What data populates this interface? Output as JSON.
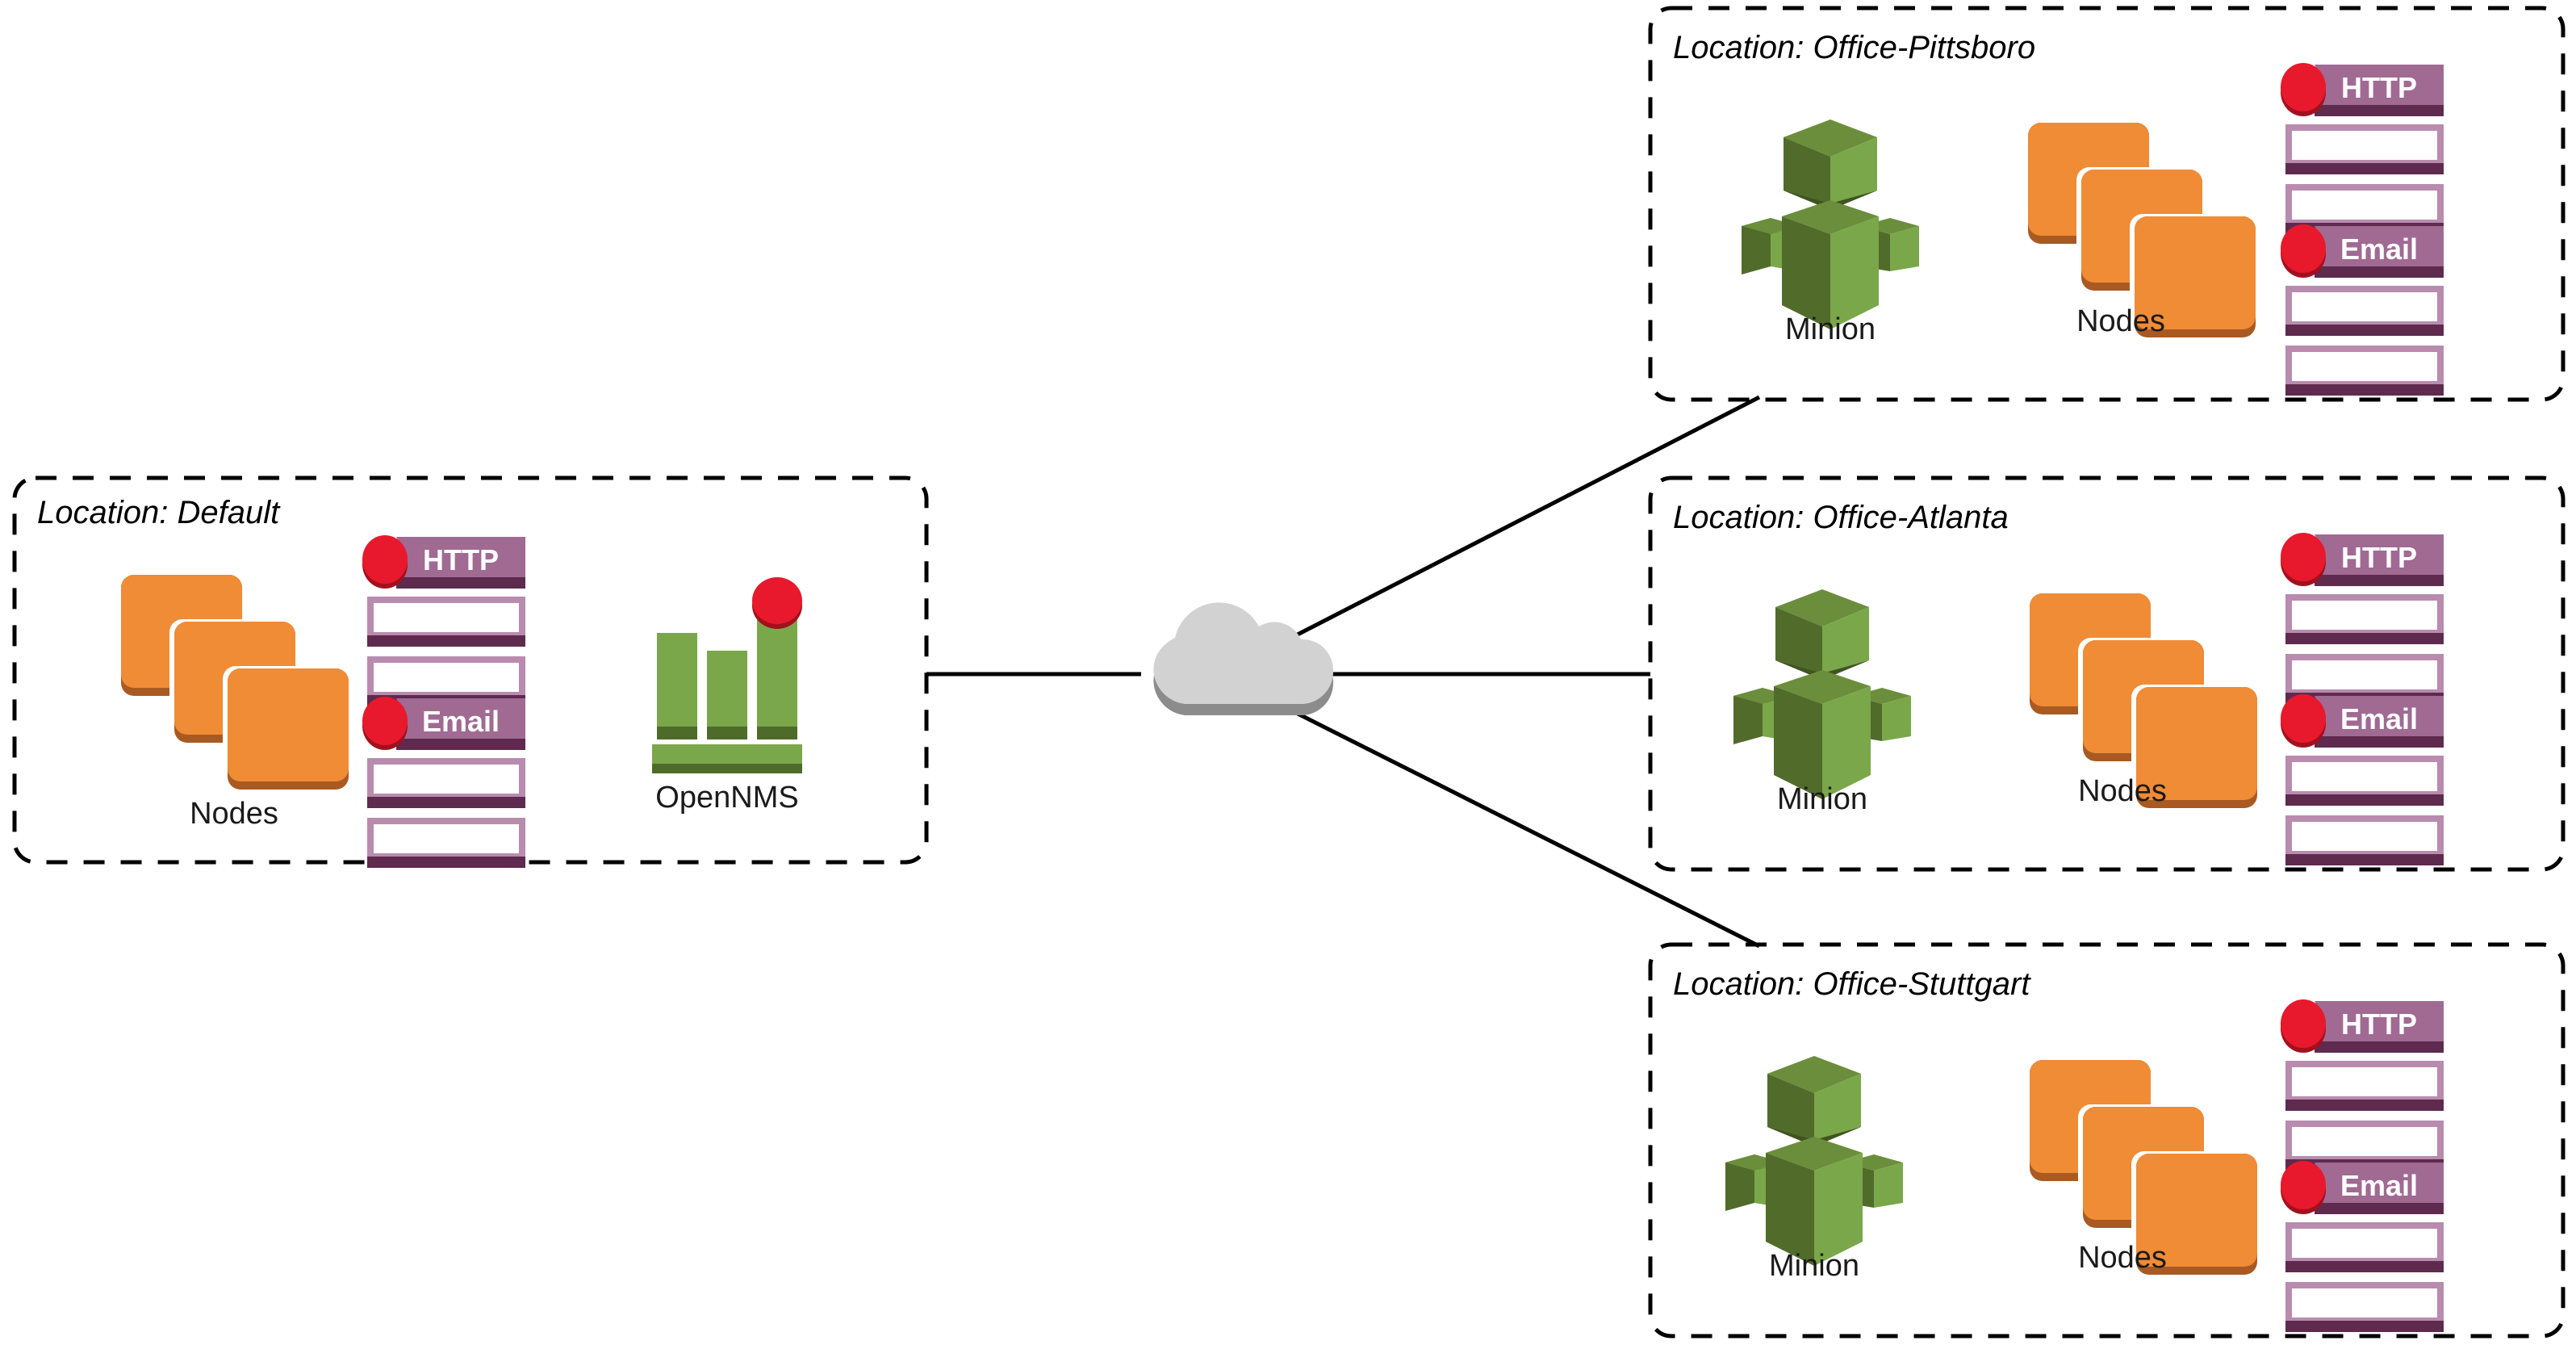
{
  "diagram": {
    "title": "OpenNMS Minion distributed monitoring topology",
    "background_color": "#ffffff",
    "line_color": "#000000",
    "palette": {
      "node_orange": "#F08B36",
      "node_orange_shadow": "#A85A22",
      "minion_green_light": "#7AA74A",
      "minion_green_dark": "#516B2B",
      "minion_green_mid": "#5E7F33",
      "service_purple": "#A06A93",
      "service_purple_dark": "#5E2A4E",
      "service_purple_mid": "#9A6B8E",
      "alert_red": "#E8192C",
      "alert_red_shadow": "#A3101D",
      "cloud_gray": "#D2D2D2",
      "cloud_gray_shadow": "#8C8C8C",
      "opennms_green": "#7AA74A",
      "opennms_green_dark": "#4F6B2A"
    }
  },
  "cloud": {
    "name": "network-cloud",
    "color": "#D2D2D2"
  },
  "connections": [
    {
      "from": "cloud",
      "to": "Default",
      "type": "horizontal-left"
    },
    {
      "from": "cloud",
      "to": "Office-Pittsboro",
      "type": "diagonal-up-right"
    },
    {
      "from": "cloud",
      "to": "Office-Atlanta",
      "type": "horizontal-right"
    },
    {
      "from": "cloud",
      "to": "Office-Stuttgart",
      "type": "diagonal-down-right"
    }
  ],
  "locations": [
    {
      "id": "default",
      "label": "Location: Default",
      "icons": [
        {
          "type": "nodes",
          "caption": "Nodes"
        },
        {
          "type": "services",
          "caption": ""
        },
        {
          "type": "opennms",
          "caption": "OpenNMS"
        }
      ],
      "services": [
        {
          "name": "HTTP",
          "status": "alert"
        },
        {
          "name": "Email",
          "status": "alert"
        }
      ]
    },
    {
      "id": "pittsboro",
      "label": "Location: Office-Pittsboro",
      "icons": [
        {
          "type": "minion",
          "caption": "Minion"
        },
        {
          "type": "nodes",
          "caption": "Nodes"
        },
        {
          "type": "services",
          "caption": ""
        }
      ],
      "services": [
        {
          "name": "HTTP",
          "status": "alert"
        },
        {
          "name": "Email",
          "status": "alert"
        }
      ]
    },
    {
      "id": "atlanta",
      "label": "Location: Office-Atlanta",
      "icons": [
        {
          "type": "minion",
          "caption": "Minion"
        },
        {
          "type": "nodes",
          "caption": "Nodes"
        },
        {
          "type": "services",
          "caption": ""
        }
      ],
      "services": [
        {
          "name": "HTTP",
          "status": "alert"
        },
        {
          "name": "Email",
          "status": "alert"
        }
      ]
    },
    {
      "id": "stuttgart",
      "label": "Location: Office-Stuttgart",
      "icons": [
        {
          "type": "minion",
          "caption": "Minion"
        },
        {
          "type": "nodes",
          "caption": "Nodes"
        },
        {
          "type": "services",
          "caption": ""
        }
      ],
      "services": [
        {
          "name": "HTTP",
          "status": "alert"
        },
        {
          "name": "Email",
          "status": "alert"
        }
      ]
    }
  ],
  "captions": {
    "nodes": "Nodes",
    "minion": "Minion",
    "opennms": "OpenNMS"
  },
  "service_names": {
    "http": "HTTP",
    "email": "Email"
  }
}
